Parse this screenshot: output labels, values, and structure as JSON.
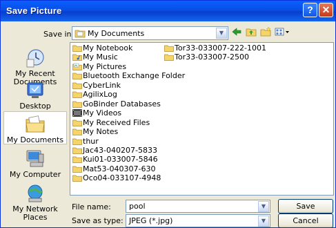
{
  "dialog": {
    "title": "Save Picture",
    "help_label": "?",
    "close_label": "✕"
  },
  "save_in": {
    "label": "Save in:",
    "value": "My Documents"
  },
  "places": [
    {
      "label": "My Recent\nDocuments",
      "icon": "recent-documents-icon"
    },
    {
      "label": "Desktop",
      "icon": "desktop-icon"
    },
    {
      "label": "My Documents",
      "icon": "my-documents-icon"
    },
    {
      "label": "My Computer",
      "icon": "my-computer-icon"
    },
    {
      "label": "My Network\nPlaces",
      "icon": "network-places-icon"
    }
  ],
  "files": {
    "column1": [
      {
        "name": "My Notebook",
        "icon": "folder"
      },
      {
        "name": "My Music",
        "icon": "music-folder"
      },
      {
        "name": "My Pictures",
        "icon": "pictures-folder"
      },
      {
        "name": "Bluetooth Exchange Folder",
        "icon": "folder"
      },
      {
        "name": "CyberLink",
        "icon": "folder"
      },
      {
        "name": "AgilixLog",
        "icon": "folder"
      },
      {
        "name": "GoBinder Databases",
        "icon": "folder"
      },
      {
        "name": "My Videos",
        "icon": "videos-folder"
      },
      {
        "name": "My Received Files",
        "icon": "folder"
      },
      {
        "name": "My Notes",
        "icon": "folder"
      },
      {
        "name": "thur",
        "icon": "folder"
      },
      {
        "name": "Jac43-040207-5833",
        "icon": "folder"
      },
      {
        "name": "Kui01-033007-5846",
        "icon": "folder"
      },
      {
        "name": "Mat53-040307-630",
        "icon": "folder"
      },
      {
        "name": "Oco04-033107-4948",
        "icon": "folder"
      }
    ],
    "column2": [
      {
        "name": "Tor33-033007-222-1001",
        "icon": "folder"
      },
      {
        "name": "Tor33-033007-2500",
        "icon": "folder"
      }
    ]
  },
  "file_name": {
    "label": "File name:",
    "value": "pool"
  },
  "save_as_type": {
    "label": "Save as type:",
    "value": "JPEG (*.jpg)"
  },
  "buttons": {
    "save": "Save",
    "cancel": "Cancel"
  },
  "colors": {
    "titlebar": "#0a4ee4",
    "dialog_bg": "#ece9d8",
    "folder": "#f5d56b",
    "border": "#7f9db9"
  }
}
